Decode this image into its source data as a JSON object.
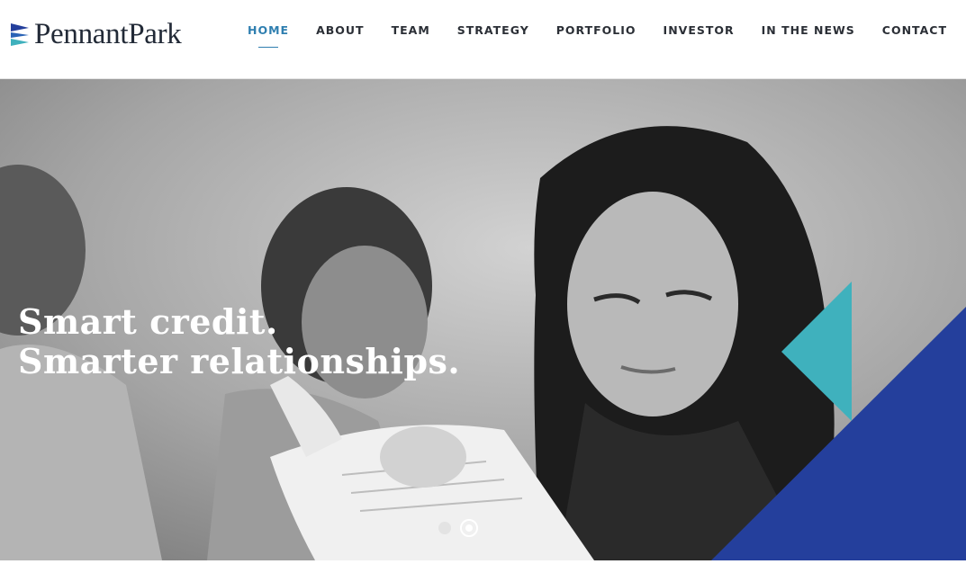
{
  "brand": {
    "name": "PennantPark"
  },
  "nav": {
    "items": [
      {
        "label": "HOME",
        "active": true
      },
      {
        "label": "ABOUT",
        "active": false
      },
      {
        "label": "TEAM",
        "active": false
      },
      {
        "label": "STRATEGY",
        "active": false
      },
      {
        "label": "PORTFOLIO",
        "active": false
      },
      {
        "label": "INVESTOR",
        "active": false
      },
      {
        "label": "IN THE NEWS",
        "active": false
      },
      {
        "label": "CONTACT",
        "active": false
      }
    ]
  },
  "hero": {
    "headline_line1": "Smart credit.",
    "headline_line2": "Smarter relationships.",
    "slides_total": 2,
    "active_slide": 2
  },
  "colors": {
    "accent_blue": "#2f7fb0",
    "navy": "#243f9c",
    "teal": "#3fb1bd",
    "text_dark": "#2b2f36"
  }
}
